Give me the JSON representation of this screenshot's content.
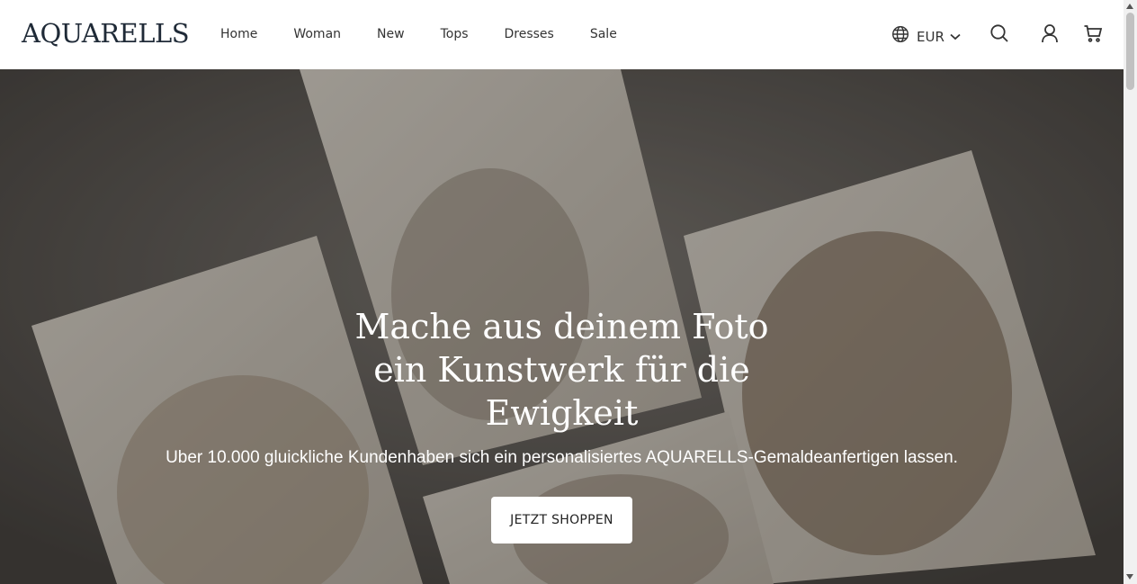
{
  "header": {
    "logo": "AQUARELLS",
    "nav": [
      "Home",
      "Woman",
      "New",
      "Tops",
      "Dresses",
      "Sale"
    ],
    "currency": "EUR"
  },
  "hero": {
    "title_lines": [
      "Mache aus deinem Foto",
      "ein Kunstwerk für die",
      "Ewigkeit"
    ],
    "subtitle": "Uber 10.000 gluickliche Kundenhaben sich ein personalisiertes AQUARELLS-Gemaldeanfertigen lassen.",
    "cta_label": "JETZT SHOPPEN"
  },
  "icons": {
    "globe": "globe-icon",
    "chevron": "chevron-down-icon",
    "search": "search-icon",
    "account": "user-icon",
    "cart": "cart-icon"
  },
  "colors": {
    "header_bg": "#ffffff",
    "logo": "#1f2a37",
    "cta_bg": "#ffffff",
    "hero_text": "#ffffff"
  }
}
